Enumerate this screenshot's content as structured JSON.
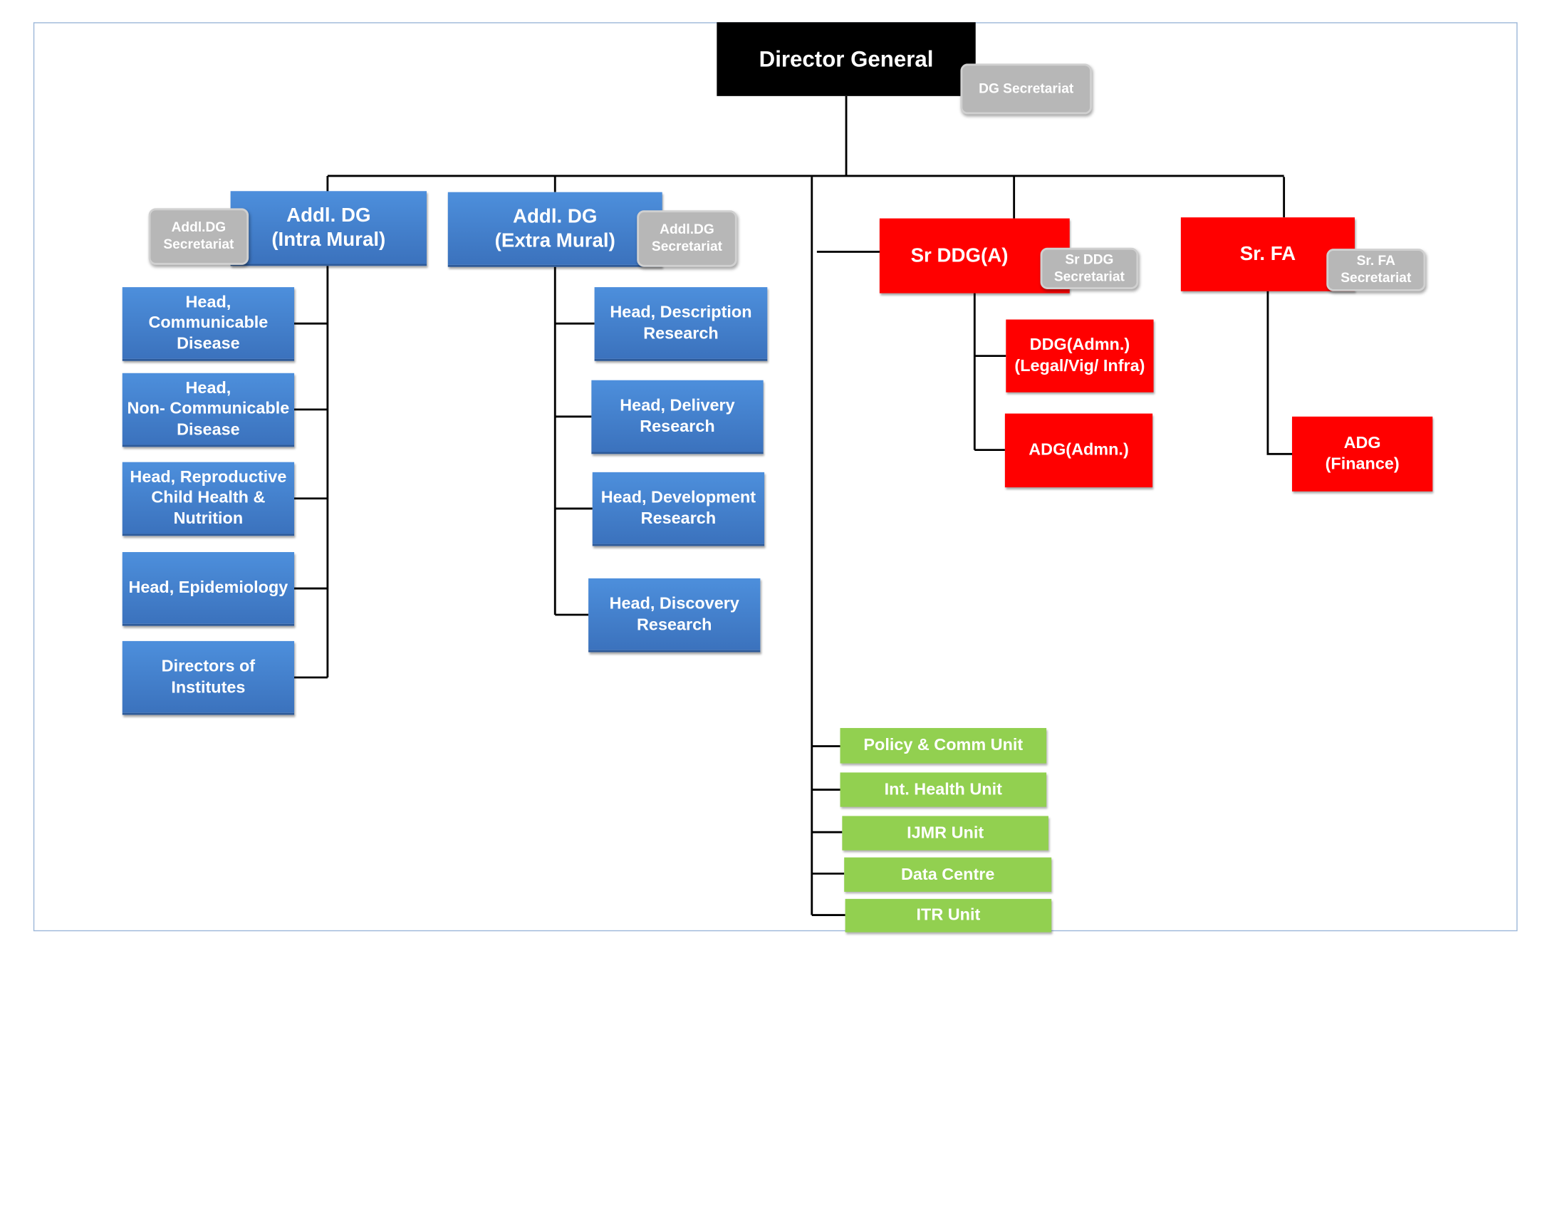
{
  "colors": {
    "top": "#000000",
    "academic": "#3b72bd",
    "admin": "#ff0000",
    "units": "#92d050",
    "secretariat": "#b7b7b7"
  },
  "director_general": {
    "label": "Director General",
    "secretariat": "DG Secretariat"
  },
  "addl_dg_intra": {
    "label": "Addl. DG\n(Intra Mural)",
    "secretariat": "Addl.DG\nSecretariat",
    "children": [
      "Head,\nCommunicable\nDisease",
      "Head,\nNon- Communicable\nDisease",
      "Head, Reproductive\nChild Health &\nNutrition",
      "Head, Epidemiology",
      "Directors of\nInstitutes"
    ]
  },
  "addl_dg_extra": {
    "label": "Addl. DG\n(Extra Mural)",
    "secretariat": "Addl.DG\nSecretariat",
    "children": [
      "Head, Description\nResearch",
      "Head, Delivery\nResearch",
      "Head, Development\nResearch",
      "Head, Discovery\nResearch"
    ]
  },
  "sr_ddg": {
    "label": "Sr DDG(A)",
    "secretariat": "Sr DDG\nSecretariat",
    "children": [
      "DDG(Admn.)\n(Legal/Vig/ Infra)",
      "ADG(Admn.)"
    ]
  },
  "sr_fa": {
    "label": "Sr. FA",
    "secretariat": "Sr. FA\nSecretariat",
    "children": [
      "ADG\n(Finance)"
    ]
  },
  "units": [
    "Policy & Comm Unit",
    "Int. Health Unit",
    "IJMR Unit",
    "Data Centre",
    "ITR Unit"
  ]
}
